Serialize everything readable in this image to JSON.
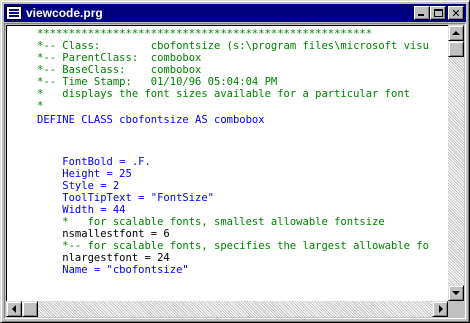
{
  "window": {
    "title": "viewcode.prg",
    "icon": "document-icon"
  },
  "code": [
    {
      "text": "*****************************************************",
      "kind": "comment"
    },
    {
      "text": "*-- Class:        cbofontsize (s:\\program files\\microsoft visu",
      "kind": "comment"
    },
    {
      "text": "*-- ParentClass:  combobox",
      "kind": "comment"
    },
    {
      "text": "*-- BaseClass:    combobox",
      "kind": "comment"
    },
    {
      "text": "*-- Time Stamp:   01/10/96 05:04:04 PM",
      "kind": "comment"
    },
    {
      "text": "*   displays the font sizes available for a particular font",
      "kind": "comment"
    },
    {
      "text": "*",
      "kind": "comment"
    },
    {
      "text": "DEFINE CLASS cbofontsize AS combobox",
      "kind": "keyword"
    },
    {
      "text": "",
      "kind": "text"
    },
    {
      "text": "",
      "kind": "text"
    },
    {
      "text": "    FontBold = .F.",
      "kind": "keyword"
    },
    {
      "text": "    Height = 25",
      "kind": "keyword"
    },
    {
      "text": "    Style = 2",
      "kind": "keyword"
    },
    {
      "text": "    ToolTipText = \"FontSize\"",
      "kind": "keyword"
    },
    {
      "text": "    Width = 44",
      "kind": "keyword"
    },
    {
      "text": "    *   for scalable fonts, smallest allowable fontsize",
      "kind": "comment"
    },
    {
      "text": "    nsmallestfont = 6",
      "kind": "text"
    },
    {
      "text": "    *-- for scalable fonts, specifies the largest allowable fo",
      "kind": "comment"
    },
    {
      "text": "    nlargestfont = 24",
      "kind": "text"
    },
    {
      "text": "    Name = \"cbofontsize\"",
      "kind": "keyword"
    }
  ],
  "colors": {
    "comment": "#008000",
    "keyword": "#0000ff",
    "text": "#000000",
    "titlebar": "#000080"
  },
  "controls": {
    "minimize": "minimize-icon",
    "maximize": "maximize-icon",
    "close_glyph": "✕"
  }
}
